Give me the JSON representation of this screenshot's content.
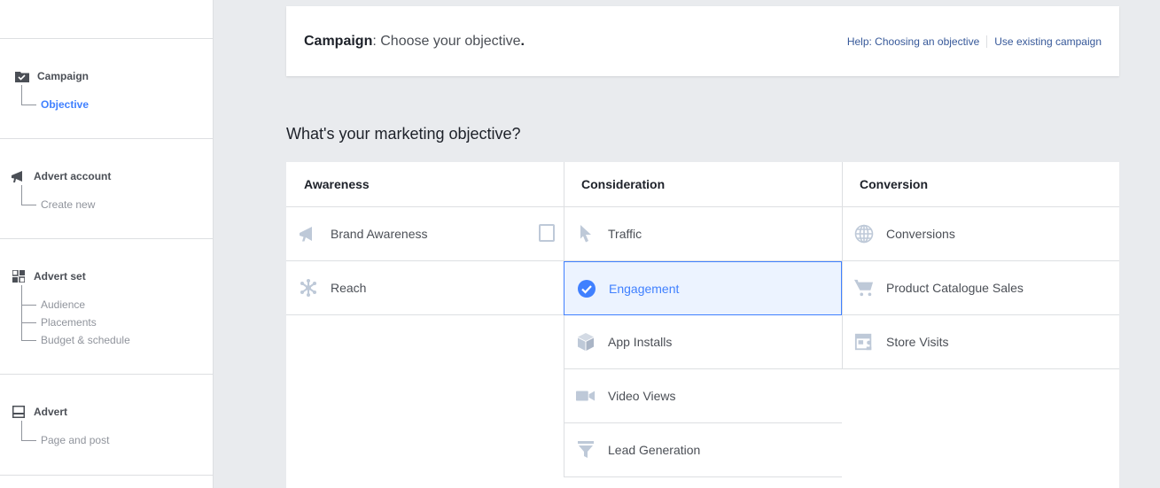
{
  "sidebar": {
    "campaign": {
      "title": "Campaign",
      "items": [
        "Objective"
      ]
    },
    "advert_account": {
      "title": "Advert account",
      "items": [
        "Create new"
      ]
    },
    "advert_set": {
      "title": "Advert set",
      "items": [
        "Audience",
        "Placements",
        "Budget & schedule"
      ]
    },
    "advert": {
      "title": "Advert",
      "items": [
        "Page and post"
      ]
    }
  },
  "header": {
    "title_bold": "Campaign",
    "title_rest": ": Choose your objective",
    "title_period": ".",
    "help_link": "Help: Choosing an objective",
    "existing_link": "Use existing campaign"
  },
  "question": "What's your marketing objective?",
  "columns": [
    {
      "title": "Awareness",
      "items": [
        {
          "label": "Brand Awareness",
          "icon": "megaphone-icon"
        },
        {
          "label": "Reach",
          "icon": "reach-icon"
        }
      ]
    },
    {
      "title": "Consideration",
      "items": [
        {
          "label": "Traffic",
          "icon": "cursor-icon"
        },
        {
          "label": "Engagement",
          "icon": "check-circle-icon"
        },
        {
          "label": "App Installs",
          "icon": "box-icon"
        },
        {
          "label": "Video Views",
          "icon": "video-camera-icon"
        },
        {
          "label": "Lead Generation",
          "icon": "funnel-icon"
        }
      ]
    },
    {
      "title": "Conversion",
      "items": [
        {
          "label": "Conversions",
          "icon": "globe-icon"
        },
        {
          "label": "Product Catalogue Sales",
          "icon": "cart-icon"
        },
        {
          "label": "Store Visits",
          "icon": "store-icon"
        }
      ]
    }
  ],
  "colors": {
    "accent": "#4080ff",
    "link": "#365899",
    "icon_grey": "#bec9d8"
  }
}
